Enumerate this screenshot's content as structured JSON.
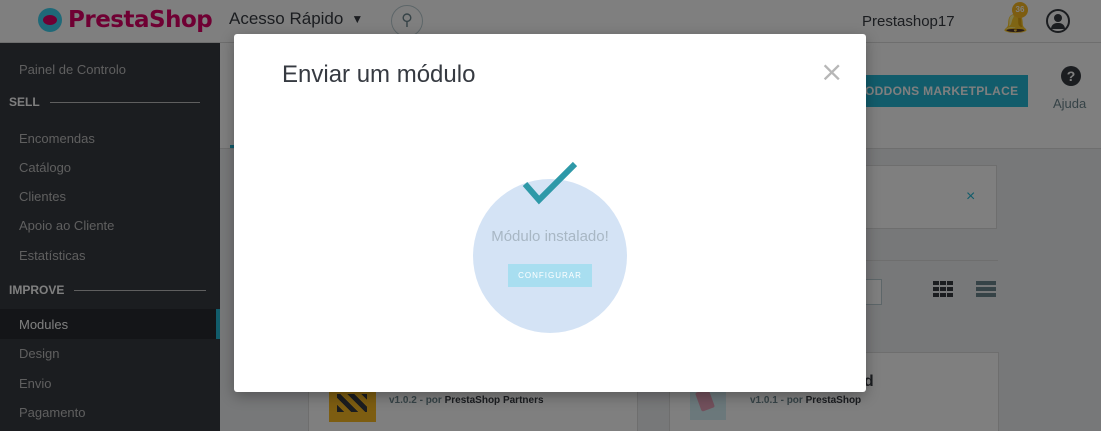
{
  "header": {
    "logo_text": "PrestaShop",
    "quick_access": "Acesso Rápido",
    "shop_name": "Prestashop17",
    "notifications_count": "36"
  },
  "sidebar": {
    "items_top": [
      {
        "label": "Painel de Controlo"
      }
    ],
    "section_sell": "SELL",
    "items_sell": [
      {
        "label": "Encomendas"
      },
      {
        "label": "Catálogo"
      },
      {
        "label": "Clientes"
      },
      {
        "label": "Apoio ao Cliente"
      },
      {
        "label": "Estatísticas"
      }
    ],
    "section_improve": "IMPROVE",
    "items_improve": [
      {
        "label": "Modules",
        "active": true
      },
      {
        "label": "Design"
      },
      {
        "label": "Envio"
      },
      {
        "label": "Pagamento"
      }
    ]
  },
  "toolbar": {
    "addons_button": "ODDONS MARKETPLACE",
    "help_label": "Ajuda",
    "help_icon": "?"
  },
  "alert": {
    "close_glyph": "×"
  },
  "cards": [
    {
      "version": "v1.0.2 - por",
      "author": "PrestaShop Partners"
    },
    {
      "title_partial": "ed",
      "version": "v1.0.1 - por",
      "author": "PrestaShop"
    }
  ],
  "modal": {
    "title": "Enviar um módulo",
    "close_glyph": "×",
    "success_text": "Módulo instalado!",
    "configure_button": "CONFIGURAR"
  },
  "colors": {
    "brand_pink": "#df0067",
    "accent_blue": "#25b9d7",
    "sidebar_bg": "#363a41",
    "success_circle": "#d4e3f5",
    "checkmark": "#2e99a8"
  },
  "icons": [
    "search-icon",
    "bell-icon",
    "user-icon",
    "help-icon",
    "close-icon",
    "checkmark-icon",
    "grid-view-icon",
    "list-view-icon",
    "chevron-down-icon"
  ]
}
